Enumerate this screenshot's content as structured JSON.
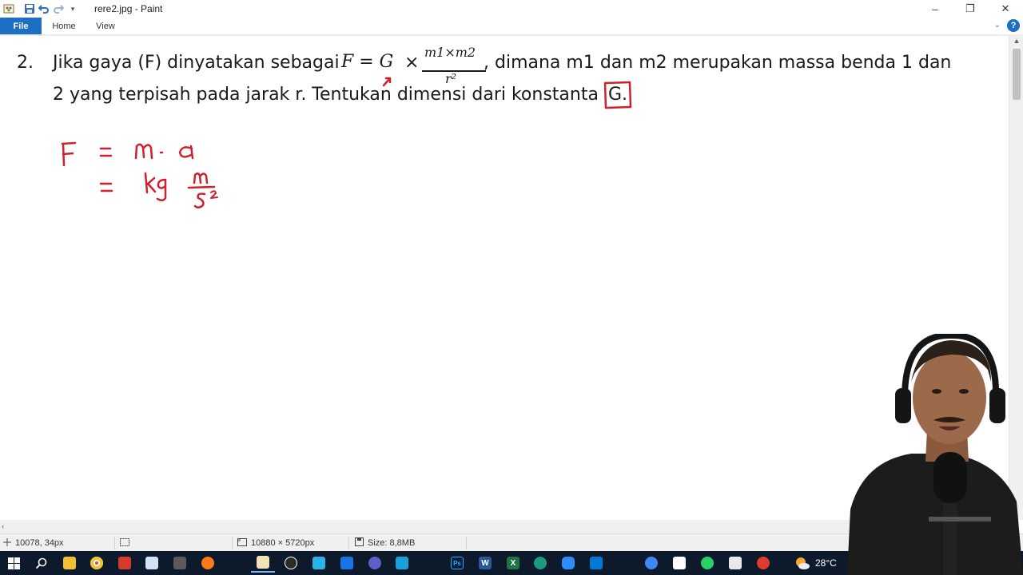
{
  "window": {
    "title": "rere2.jpg - Paint",
    "minimize_label": "–",
    "restore_label": "❐",
    "close_label": "✕"
  },
  "ribbon": {
    "tabs": [
      "File",
      "Home",
      "View"
    ],
    "help_label": "?"
  },
  "question": {
    "number": "2.",
    "line1_before": "Jika gaya (F) dinyatakan sebagai",
    "formula_lhs": "F = G",
    "formula_times": "×",
    "formula_numerator": "m1×m2",
    "formula_denominator": "r²",
    "line1_after": ", dimana m1 dan m2 merupakan massa benda 1 dan",
    "line2": "2 yang terpisah pada jarak r. Tentukan dimensi dari konstanta",
    "boxed_term": "G."
  },
  "handwriting": {
    "line1": "F = m.a",
    "line2": "= kg m/s²"
  },
  "statusbar": {
    "cursor_position": "10078, 34px",
    "image_dimensions": "10880 × 5720px",
    "file_size": "Size: 8,8MB"
  },
  "taskbar": {
    "apps": [
      "start",
      "search",
      "file-explorer",
      "chrome",
      "pdf-app",
      "notepad",
      "calculator",
      "firefox",
      "paint",
      "obs",
      "snipping",
      "photos",
      "teams",
      "chat",
      "photoshop",
      "word",
      "excel",
      "edge",
      "zoom",
      "mail",
      "chrome-alt",
      "file",
      "whatsapp",
      "gallery",
      "recorder"
    ],
    "temperature": "28°C",
    "colors": {
      "background": "#0c1a2b",
      "accent": "#1e6ec4",
      "pen": "#d0202c"
    }
  }
}
